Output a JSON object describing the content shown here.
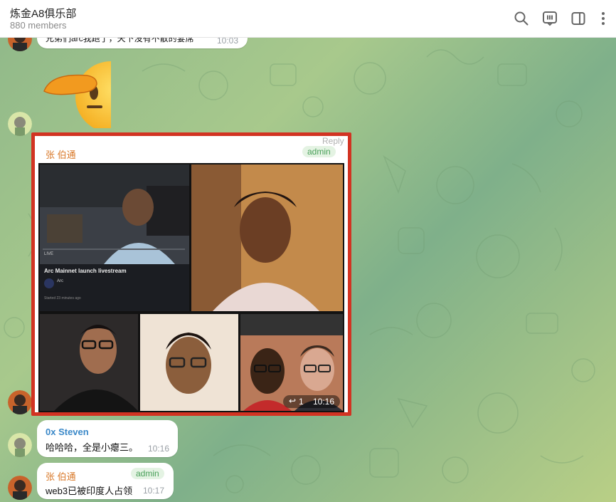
{
  "header": {
    "title": "炼金A8俱乐部",
    "subtitle": "880 members",
    "icons": [
      "search-icon",
      "live-poll-icon",
      "sidebar-toggle-icon",
      "more-icon"
    ]
  },
  "messages": {
    "top": {
      "text": "兄弟们arc我跑了，天下没有不散的宴席",
      "time": "10:03"
    },
    "sticker": {
      "name": "saluting-face-emoji"
    },
    "media": {
      "sender": "张 伯通",
      "badge": "admin",
      "reply_hint": "Reply",
      "inner_caption": "Arc Mainnet launch livestream",
      "inner_live": "LIVE",
      "inner_channel": "Arc",
      "inner_started": "Started 23 minutes ago",
      "forward_count": "1",
      "time": "10:16"
    },
    "steven": {
      "sender": "0x Steven",
      "text": "哈哈哈，全是小瘪三。",
      "time": "10:16"
    },
    "last": {
      "sender": "张 伯通",
      "badge": "admin",
      "text": "web3已被印度人占领",
      "time": "10:17"
    }
  },
  "colors": {
    "accent_red": "#d23322",
    "admin_green": "#4aa05a",
    "sender_orange": "#d97a2b",
    "sender_blue": "#3a88c8"
  }
}
